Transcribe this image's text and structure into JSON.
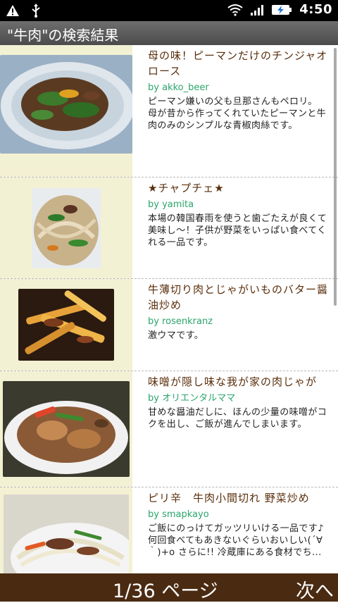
{
  "status": {
    "time": "4:50"
  },
  "header": {
    "title": "\"牛肉\"の検索結果"
  },
  "results": [
    {
      "title": "母の味！ピーマンだけのチンジャオロース",
      "author": "by akko_beer",
      "desc": "ピーマン嫌いの父も旦那さんもペロリ。\n母が昔から作ってくれていたピーマンと牛肉のみのシンプルな青椒肉絲です。"
    },
    {
      "title": "★チャプチェ★",
      "author": "by yamita",
      "desc": "本場の韓国春雨を使うと歯ごたえが良くて美味し～！子供が野菜をいっぱい食べてくれる一品です。"
    },
    {
      "title": "牛薄切り肉とじゃがいものバター醤油炒め",
      "author": "by rosenkranz",
      "desc": "激ウマです。"
    },
    {
      "title": "味噌が隠し味な我が家の肉じゃが",
      "author": "by オリエンタルママ",
      "desc": "甘めな醤油だしに、ほんの少量の味噌がコクを出し、ご飯が進んでしまいます。"
    },
    {
      "title": "ピリ辛　牛肉小間切れ 野菜炒め",
      "author": "by smapkayo",
      "desc": "ご飯にのっけてガッツリいける一品です♪ 何回食べてもあきないぐらいおいしい(´∀｀)+o さらに!! 冷蔵庫にある食材でち..."
    }
  ],
  "footer": {
    "page": "1/36 ページ",
    "next": "次へ"
  }
}
